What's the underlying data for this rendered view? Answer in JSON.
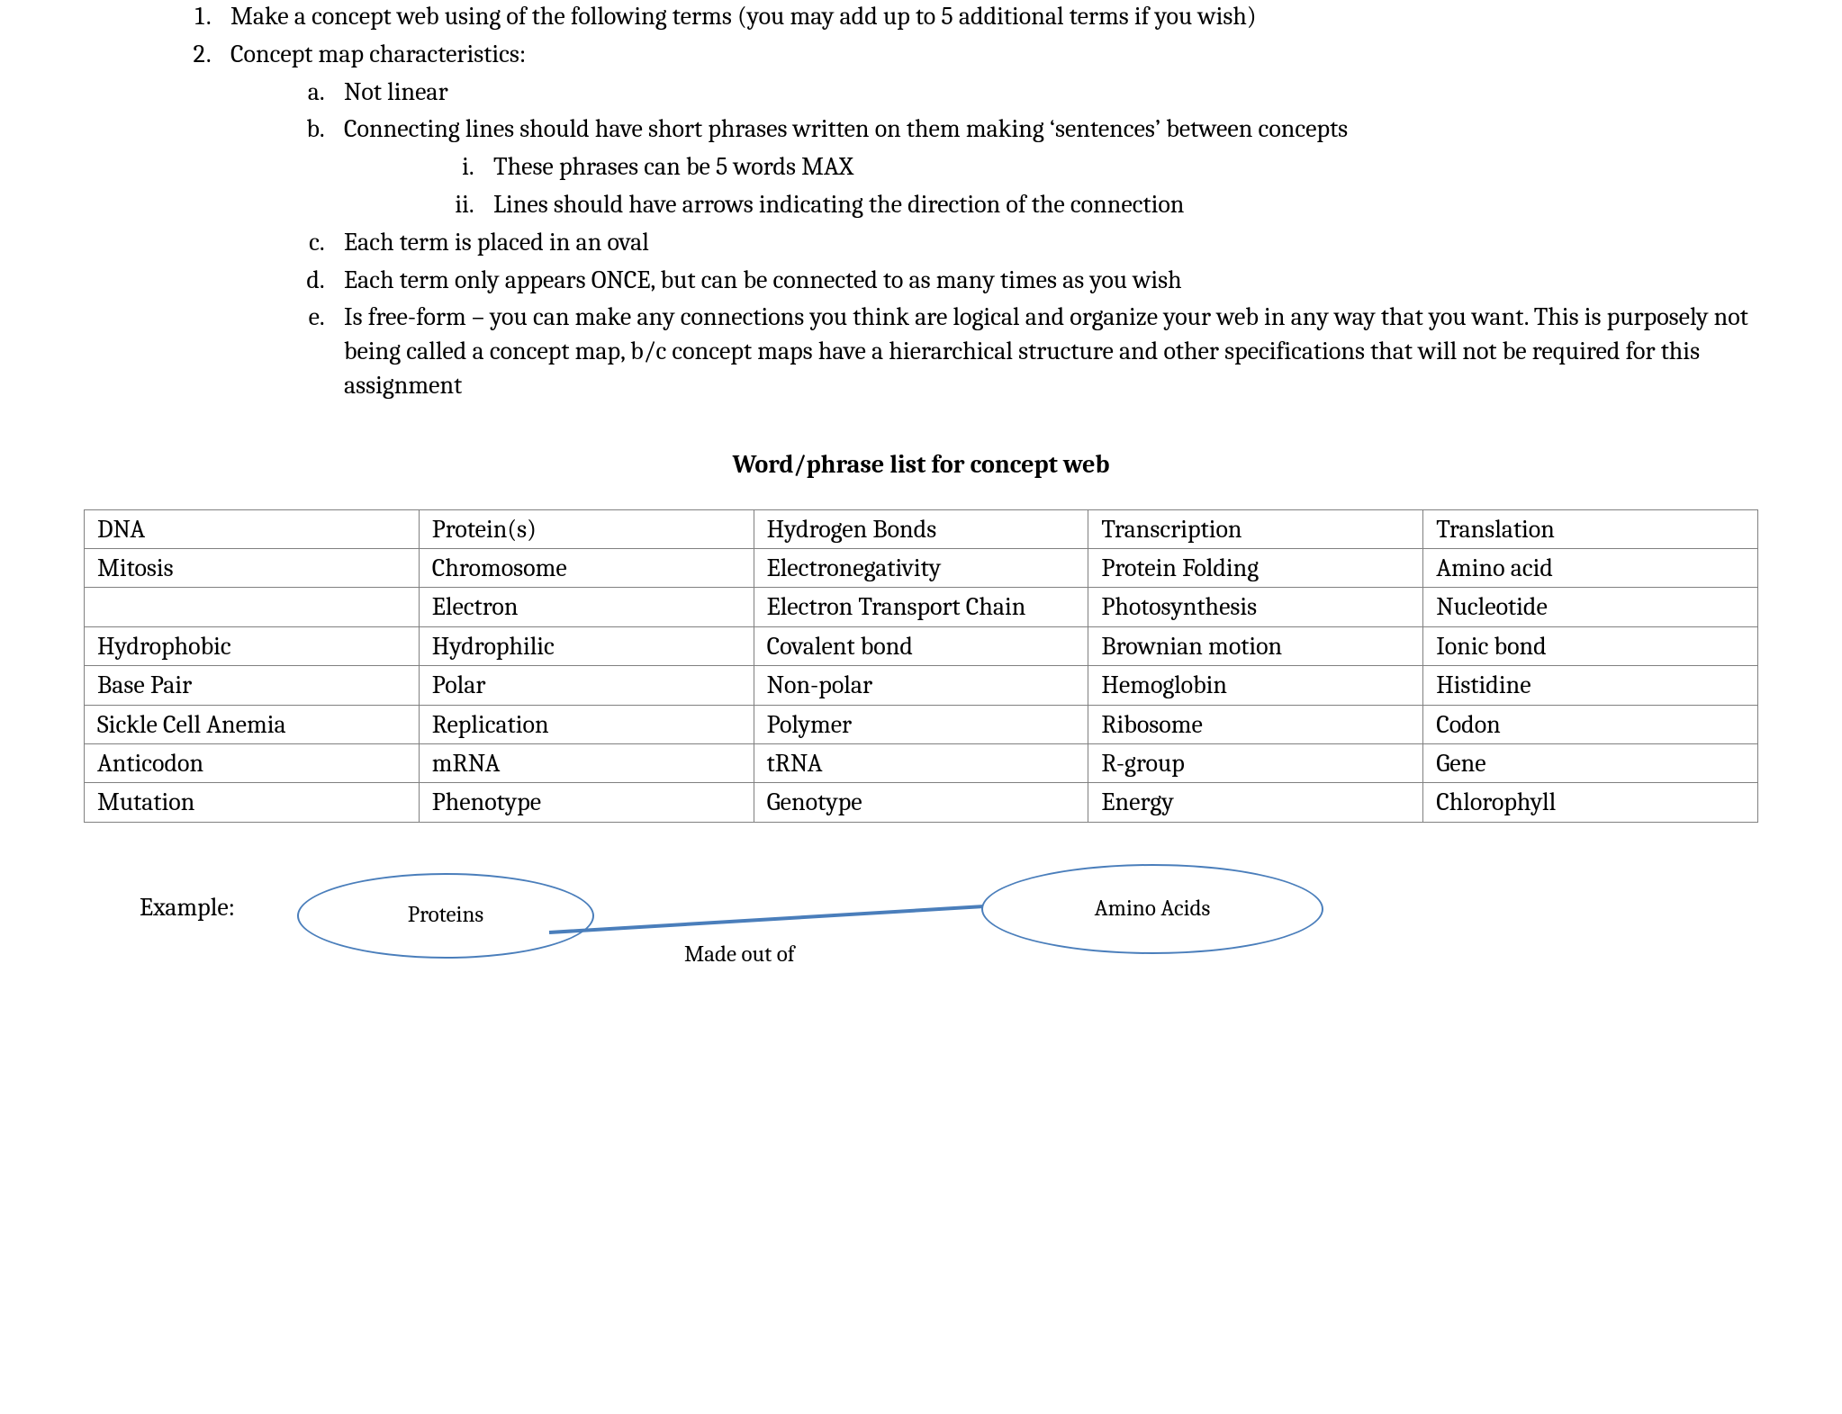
{
  "numbered": {
    "item1": "Make a concept web using of the following terms (you may add up to 5 additional terms if you wish)",
    "item2": "Concept map characteristics:",
    "sub": {
      "a": "Not linear",
      "b": "Connecting lines should have short phrases written on them making ‘sentences’ between concepts",
      "b_i": "These phrases can be 5 words MAX",
      "b_ii": "Lines should have arrows indicating the direction of the connection",
      "c": "Each term is placed in an oval",
      "d": "Each term only appears ONCE, but can be connected to as many times as you wish",
      "e": "Is free-form – you can make any connections you think are logical and organize your web in any way that you want. This is purposely not being called a concept map, b/c concept maps have a hierarchical structure and other specifications that will not be required for this assignment"
    }
  },
  "list_heading": "Word/phrase list for concept web",
  "table": {
    "rows": [
      [
        "DNA",
        "Protein(s)",
        "Hydrogen Bonds",
        "Transcription",
        "Translation"
      ],
      [
        "Mitosis",
        "Chromosome",
        "Electronegativity",
        "Protein Folding",
        "Amino acid"
      ],
      [
        "",
        "Electron",
        "Electron Transport Chain",
        "Photosynthesis",
        "Nucleotide"
      ],
      [
        "Hydrophobic",
        "Hydrophilic",
        "Covalent bond",
        "Brownian motion",
        "Ionic bond"
      ],
      [
        "Base Pair",
        "Polar",
        "Non-polar",
        "Hemoglobin",
        "Histidine"
      ],
      [
        "Sickle Cell Anemia",
        "Replication",
        "Polymer",
        "Ribosome",
        "Codon"
      ],
      [
        "Anticodon",
        "mRNA",
        "tRNA",
        "R-group",
        "Gene"
      ],
      [
        "Mutation",
        "Phenotype",
        "Genotype",
        "Energy",
        "Chlorophyll"
      ]
    ]
  },
  "example": {
    "label": "Example:",
    "left_bubble": "Proteins",
    "right_bubble": "Amino Acids",
    "edge_label": "Made out of"
  }
}
